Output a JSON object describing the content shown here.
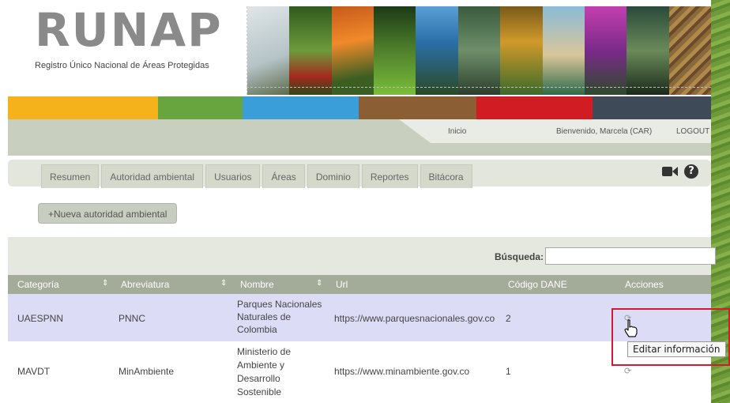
{
  "header": {
    "logo": "RUNAP",
    "subtitle": "Registro Único Nacional de Áreas Protegidas"
  },
  "colors": {
    "bar": [
      "#f5b21b",
      "#69a53f",
      "#3a9fd8",
      "#8c5e34",
      "#d21c24",
      "#3f4a59"
    ],
    "accent": "#d61a2a"
  },
  "nav": {
    "home": "Inicio",
    "welcome": "Bienvenido, Marcela (CAR)",
    "logout": "LOGOUT"
  },
  "menu": {
    "tabs": [
      "Resumen",
      "Autoridad ambiental",
      "Usuarios",
      "Áreas",
      "Dominio",
      "Reportes",
      "Bitácora"
    ],
    "icons": [
      "video-camera-icon",
      "help-icon"
    ]
  },
  "actions": {
    "add": "+Nueva autoridad ambiental"
  },
  "search": {
    "label": "Búsqueda:",
    "value": ""
  },
  "table": {
    "columns": [
      "Categoría",
      "Abreviatura",
      "Nombre",
      "Url",
      "Código DANE",
      "Acciones"
    ],
    "rows": [
      {
        "categoria": "UAESPNN",
        "abreviatura": "PNNC",
        "nombre": [
          "Parques Nacionales",
          "Naturales de",
          "Colombia"
        ],
        "url": "https://www.parquesnacionales.gov.co",
        "codigo": "2",
        "accion_icon": "refresh-icon"
      },
      {
        "categoria": "MAVDT",
        "abreviatura": "MinAmbiente",
        "nombre": [
          "Ministerio de",
          "Ambiente y",
          "Desarrollo",
          "Sostenible"
        ],
        "url": "https://www.minambiente.gov.co",
        "codigo": "1",
        "accion_icon": "refresh-icon"
      }
    ]
  },
  "tooltip": "Editar información",
  "glyphs": {
    "sort": "⇕",
    "refresh": "⟳",
    "help": "?"
  }
}
